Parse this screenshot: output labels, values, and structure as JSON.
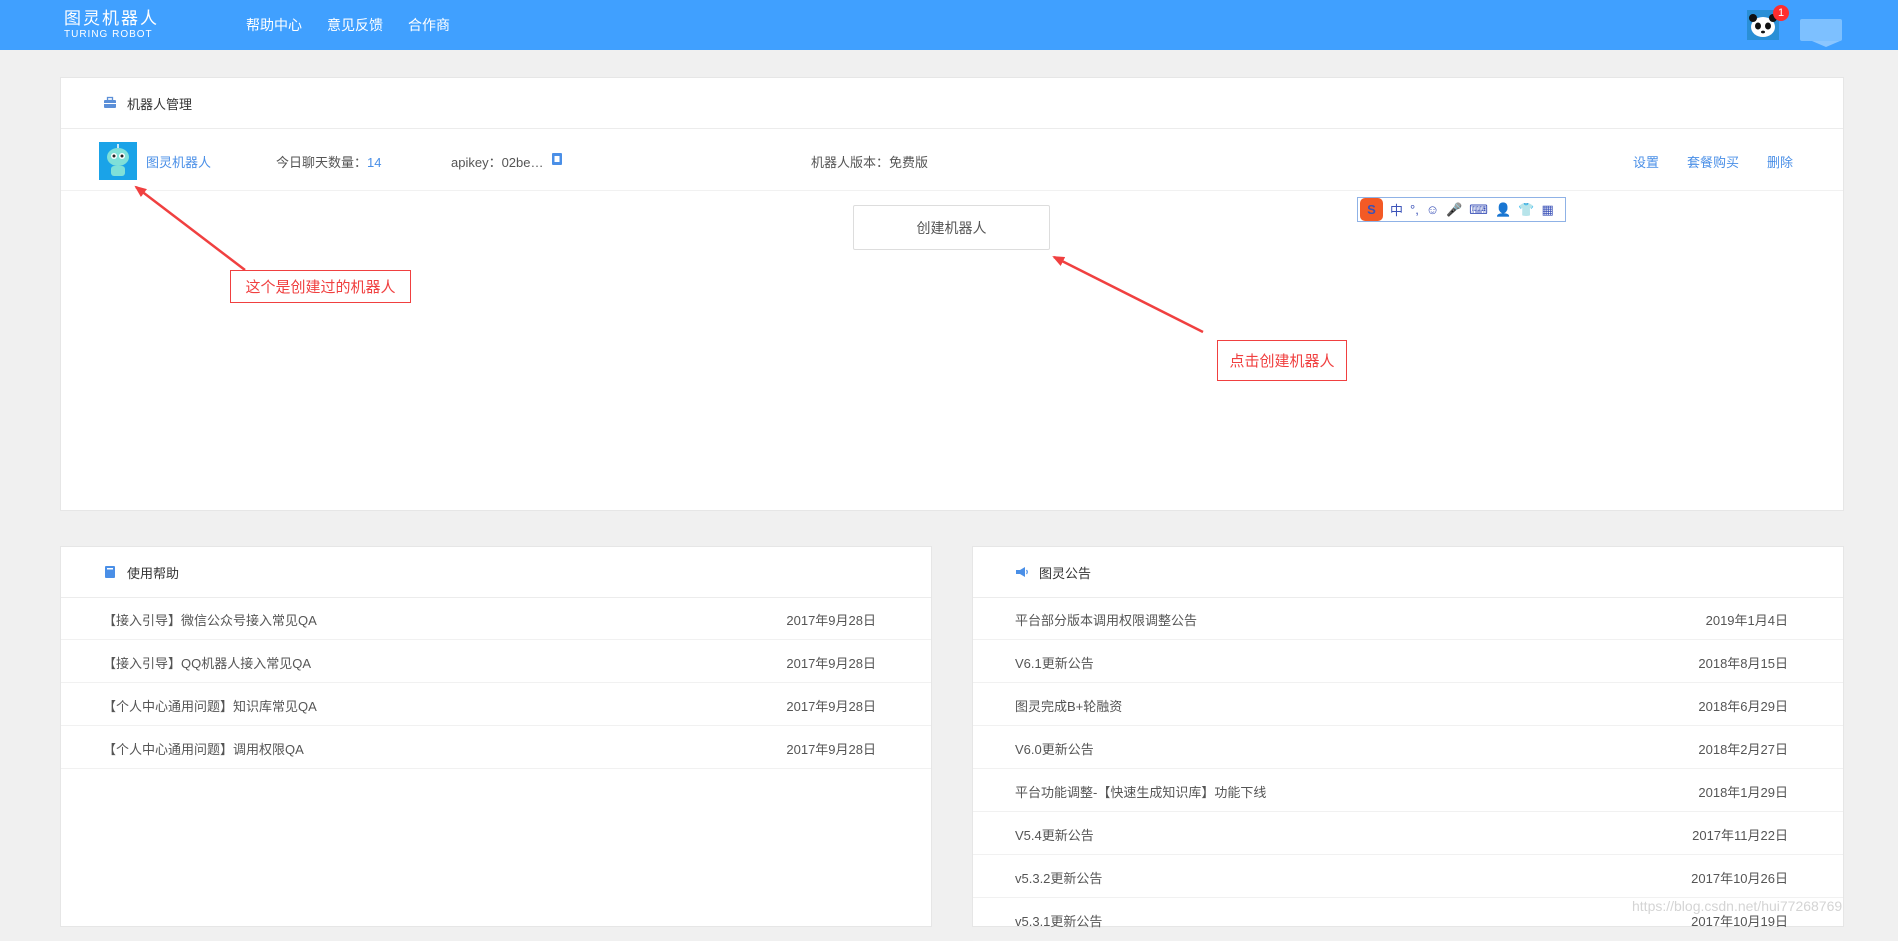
{
  "header": {
    "logo_cn": "图灵机器人",
    "logo_en": "TURING ROBOT",
    "nav": [
      "帮助中心",
      "意见反馈",
      "合作商"
    ],
    "badge_count": "1"
  },
  "robot_panel": {
    "title": "机器人管理",
    "robot": {
      "name": "图灵机器人",
      "chat_label": "今日聊天数量：",
      "chat_count": "14",
      "apikey": "apikey：02be…",
      "version": "机器人版本：免费版"
    },
    "actions": [
      "设置",
      "套餐购买",
      "删除"
    ],
    "create_button": "创建机器人"
  },
  "ime_toolbar": {
    "logo": "S",
    "items": [
      "中",
      "°,",
      "☺",
      "🎤",
      "⌨",
      "👤",
      "👕",
      "▦"
    ]
  },
  "annotations": {
    "created": "这个是创建过的机器人",
    "click_create": "点击创建机器人"
  },
  "help_panel": {
    "title": "使用帮助",
    "items": [
      {
        "title": "【接入引导】微信公众号接入常见QA",
        "date": "2017年9月28日"
      },
      {
        "title": "【接入引导】QQ机器人接入常见QA",
        "date": "2017年9月28日"
      },
      {
        "title": "【个人中心通用问题】知识库常见QA",
        "date": "2017年9月28日"
      },
      {
        "title": "【个人中心通用问题】调用权限QA",
        "date": "2017年9月28日"
      }
    ]
  },
  "notice_panel": {
    "title": "图灵公告",
    "items": [
      {
        "title": "平台部分版本调用权限调整公告",
        "date": "2019年1月4日"
      },
      {
        "title": "V6.1更新公告",
        "date": "2018年8月15日"
      },
      {
        "title": "图灵完成B+轮融资",
        "date": "2018年6月29日"
      },
      {
        "title": "V6.0更新公告",
        "date": "2018年2月27日"
      },
      {
        "title": "平台功能调整-【快速生成知识库】功能下线",
        "date": "2018年1月29日"
      },
      {
        "title": "V5.4更新公告",
        "date": "2017年11月22日"
      },
      {
        "title": "v5.3.2更新公告",
        "date": "2017年10月26日"
      },
      {
        "title": "v5.3.1更新公告",
        "date": "2017年10月19日"
      }
    ]
  },
  "watermark": "https://blog.csdn.net/hui77268769",
  "colors": {
    "header_bg": "#40a0ff",
    "link": "#4a8fe7",
    "annotation": "#f04040"
  }
}
